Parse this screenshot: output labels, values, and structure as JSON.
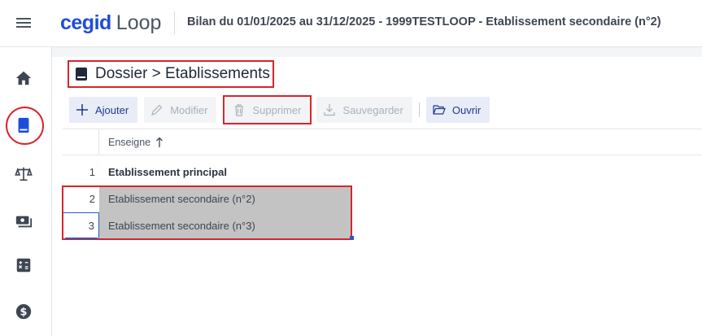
{
  "header": {
    "brand_primary": "cegid",
    "brand_secondary": "Loop",
    "context": "Bilan du 01/01/2025 au 31/12/2025 - 1999TESTLOOP - Etablissement secondaire (n°2)"
  },
  "sidebar": {
    "items": [
      {
        "icon": "home-icon"
      },
      {
        "icon": "book-icon",
        "active": true
      },
      {
        "icon": "balance-scale-icon"
      },
      {
        "icon": "money-icon"
      },
      {
        "icon": "calculator-icon"
      },
      {
        "icon": "dollar-icon"
      }
    ]
  },
  "page": {
    "title": "Dossier > Etablissements"
  },
  "toolbar": {
    "add_label": "Ajouter",
    "edit_label": "Modifier",
    "delete_label": "Supprimer",
    "save_label": "Sauvegarder",
    "open_label": "Ouvrir"
  },
  "grid": {
    "column_header": "Enseigne",
    "rows": [
      {
        "num": "1",
        "name": "Etablissement principal"
      },
      {
        "num": "2",
        "name": "Etablissement secondaire (n°2)"
      },
      {
        "num": "3",
        "name": "Etablissement secondaire (n°3)"
      }
    ]
  },
  "colors": {
    "brand_blue": "#1d4ed8",
    "highlight_red": "#d8242e",
    "selection_gray": "#c3c3c3",
    "focus_blue": "#2b58c6"
  }
}
